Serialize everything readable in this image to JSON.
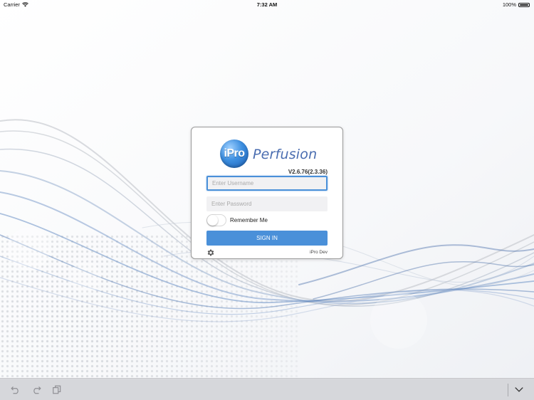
{
  "status_bar": {
    "carrier": "Carrier",
    "time": "7:32 AM",
    "battery": "100%"
  },
  "login": {
    "logo_badge": "iPro",
    "logo_word": "Perfusion",
    "version": "V2.6.76(2.3.36)",
    "username_placeholder": "Enter Username",
    "password_placeholder": "Enter Password",
    "remember_label": "Remember Me",
    "remember_on": false,
    "sign_in_label": "SIGN IN",
    "server_name": "iPro Dev"
  },
  "toolbar": {
    "icons": [
      "undo-icon",
      "redo-icon",
      "copy-icon",
      "chevron-down-icon"
    ]
  },
  "colors": {
    "accent": "#4a90d9",
    "logo_text": "#4a6db0",
    "toolbar_bg": "#d6d7db"
  }
}
